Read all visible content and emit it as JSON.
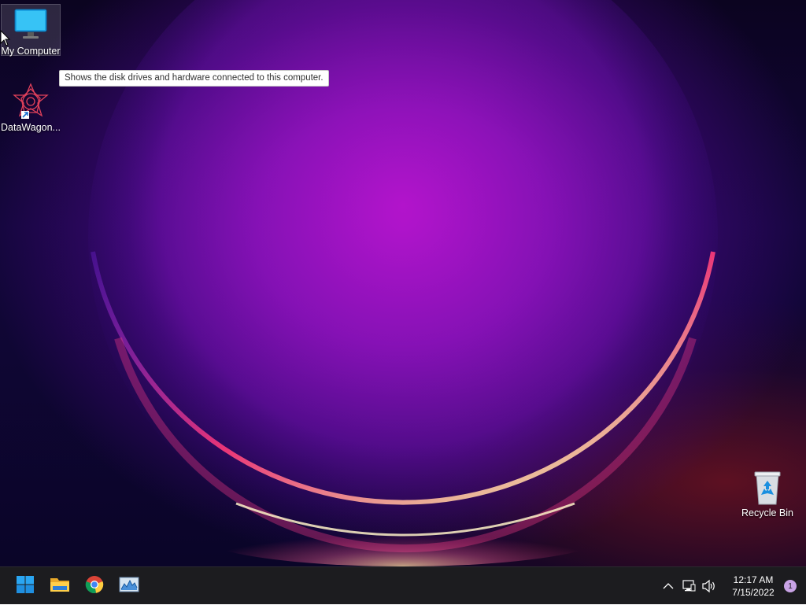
{
  "desktop": {
    "icons": [
      {
        "label": "My Computer",
        "icon": "monitor-icon",
        "selected": true
      },
      {
        "label": "DataWagon...",
        "icon": "datawagon-app-icon",
        "shortcut": true
      },
      {
        "label": "Recycle Bin",
        "icon": "recycle-bin-icon"
      }
    ],
    "tooltip": "Shows the disk drives and hardware connected to this computer."
  },
  "taskbar": {
    "pinned": [
      {
        "name": "Start",
        "icon": "windows-start-icon"
      },
      {
        "name": "File Explorer",
        "icon": "folder-icon"
      },
      {
        "name": "Google Chrome",
        "icon": "chrome-icon"
      },
      {
        "name": "Performance Monitor",
        "icon": "chart-monitor-icon"
      }
    ],
    "tray": {
      "icons": [
        "chevron-up-icon",
        "network-icon",
        "volume-icon"
      ],
      "time": "12:17 AM",
      "date": "7/15/2022",
      "notification_count": "1"
    }
  },
  "colors": {
    "taskbar": "#1c1c1f",
    "wallpaper_glow": "#b014cc",
    "notification_badge": "#c9a3e6"
  }
}
